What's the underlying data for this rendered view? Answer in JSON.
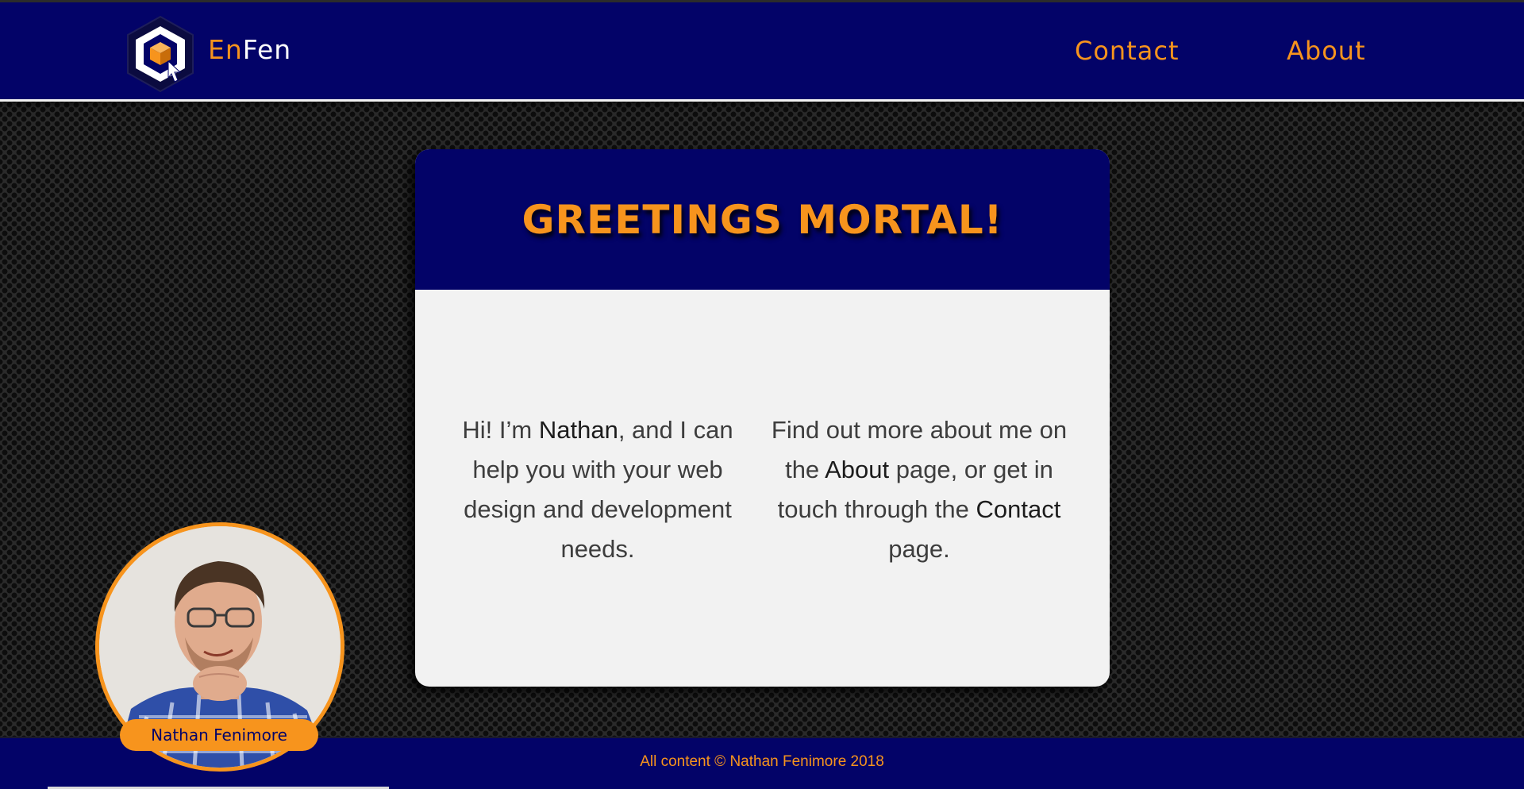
{
  "header": {
    "brand_en": "En",
    "brand_fen": "Fen",
    "nav": {
      "contact_label": "Contact",
      "about_label": "About"
    }
  },
  "card": {
    "title": "GREETINGS MORTAL!",
    "left": {
      "part1": "Hi! I’m ",
      "name": "Nathan",
      "part2": ", and I can help you with your web design and development needs."
    },
    "right": {
      "part1": "Find out more about me on the ",
      "about_link": "About",
      "part2": " page, or get in touch through the ",
      "contact_link": "Contact",
      "part3": " page."
    }
  },
  "avatar": {
    "name": "Nathan Fenimore"
  },
  "footer": {
    "copyright": "All content © Nathan Fenimore 2018"
  },
  "colors": {
    "navy": "#030368",
    "orange": "#f7941d",
    "card_bg": "#f2f2f2",
    "text": "#3d3d3d"
  }
}
